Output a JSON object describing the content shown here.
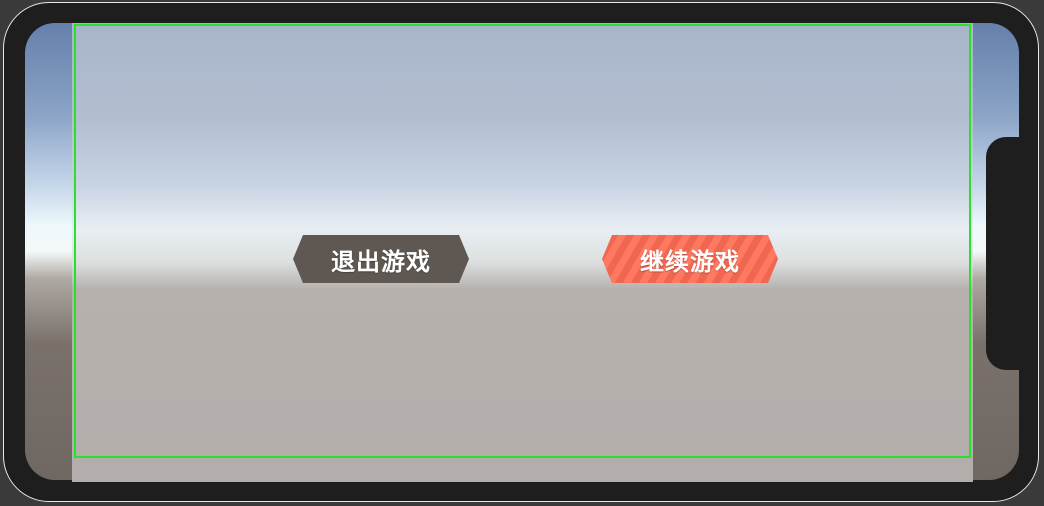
{
  "menu": {
    "exit_label": "退出游戏",
    "continue_label": "继续游戏"
  },
  "colors": {
    "exit_button": "#5f5752",
    "continue_button": "#ff7860",
    "safe_area_outline": "#2be02b",
    "device_frame": "#1e1e1e"
  }
}
